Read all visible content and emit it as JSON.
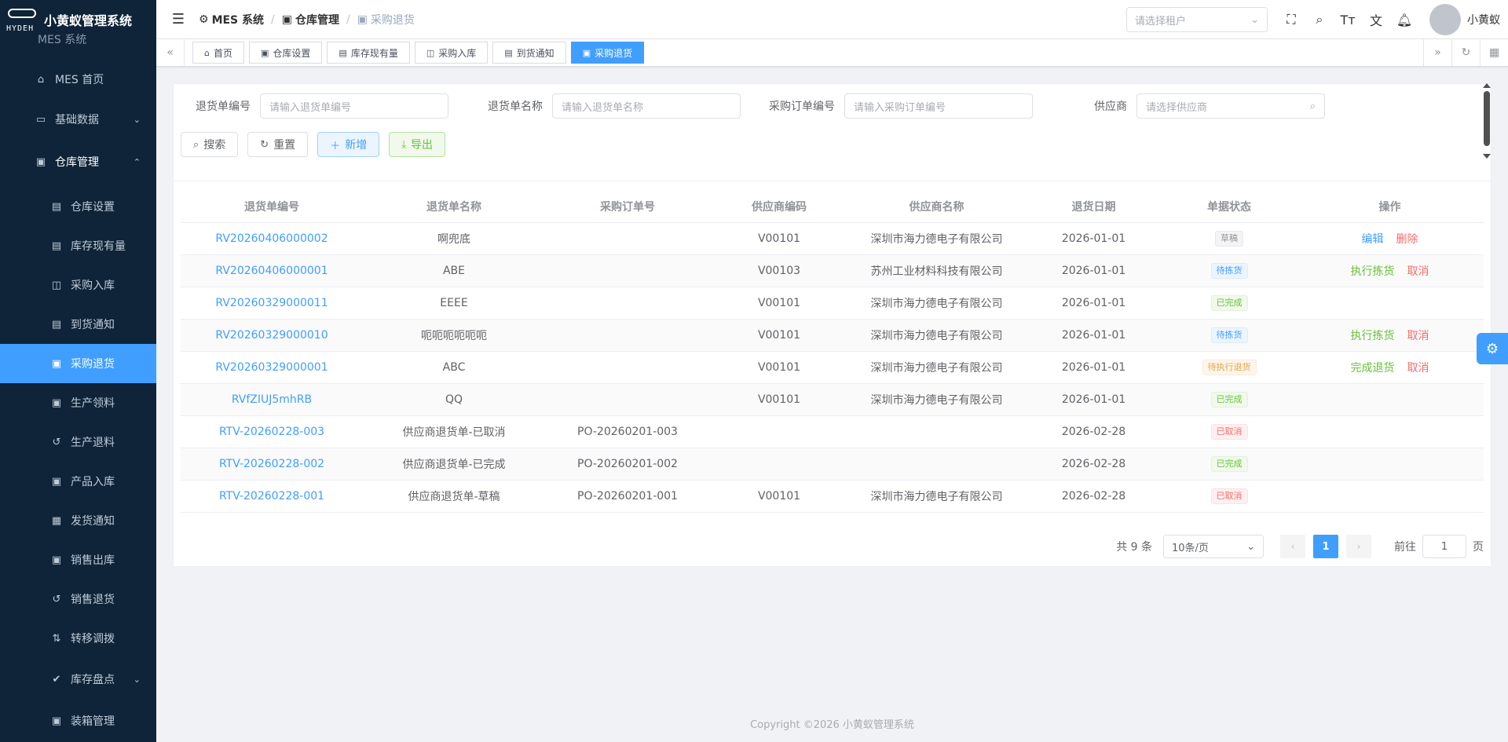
{
  "app": {
    "title": "小黄蚁管理系统",
    "logo_text": "HYDEH",
    "logo_sub": "MES 系统"
  },
  "sidebar": {
    "items": [
      {
        "label": "MES 首页",
        "icon": "home-icon",
        "glyph": "⌂",
        "level": 1,
        "active": false,
        "arrow": ""
      },
      {
        "label": "基础数据",
        "icon": "monitor-icon",
        "glyph": "▭",
        "level": 1,
        "active": false,
        "arrow": "⌄"
      },
      {
        "label": "仓库管理",
        "icon": "warehouse-icon",
        "glyph": "▣",
        "level": 1,
        "active": false,
        "arrow": "⌃",
        "parent": true
      },
      {
        "label": "仓库设置",
        "icon": "document-icon",
        "glyph": "▤",
        "level": 2,
        "active": false
      },
      {
        "label": "库存现有量",
        "icon": "document-icon",
        "glyph": "▤",
        "level": 2,
        "active": false
      },
      {
        "label": "采购入库",
        "icon": "bag-icon",
        "glyph": "◫",
        "level": 2,
        "active": false
      },
      {
        "label": "到货通知",
        "icon": "document-icon",
        "glyph": "▤",
        "level": 2,
        "active": false
      },
      {
        "label": "采购退货",
        "icon": "box-icon",
        "glyph": "▣",
        "level": 2,
        "active": true
      },
      {
        "label": "生产领料",
        "icon": "box-icon",
        "glyph": "▣",
        "level": 2,
        "active": false
      },
      {
        "label": "生产退料",
        "icon": "return-icon",
        "glyph": "↺",
        "level": 2,
        "active": false
      },
      {
        "label": "产品入库",
        "icon": "box-icon",
        "glyph": "▣",
        "level": 2,
        "active": false
      },
      {
        "label": "发货通知",
        "icon": "delivery-icon",
        "glyph": "▦",
        "level": 2,
        "active": false
      },
      {
        "label": "销售出库",
        "icon": "box-icon",
        "glyph": "▣",
        "level": 2,
        "active": false
      },
      {
        "label": "销售退货",
        "icon": "return-icon",
        "glyph": "↺",
        "level": 2,
        "active": false
      },
      {
        "label": "转移调拨",
        "icon": "transfer-icon",
        "glyph": "⇅",
        "level": 2,
        "active": false
      },
      {
        "label": "库存盘点",
        "icon": "check-circle-icon",
        "glyph": "✔",
        "level": 2,
        "active": false,
        "arrow": "⌄"
      },
      {
        "label": "装箱管理",
        "icon": "box-icon",
        "glyph": "▣",
        "level": 2,
        "active": false
      }
    ]
  },
  "navbar": {
    "breadcrumb": [
      "MES 系统",
      "仓库管理",
      "采购退货"
    ],
    "tenant_placeholder": "请选择租户",
    "username": "小黄蚁"
  },
  "tags": [
    "首页",
    "仓库设置",
    "库存现有量",
    "采购入库",
    "到货通知",
    "采购退货"
  ],
  "active_tag": "采购退货",
  "search": {
    "fields": [
      {
        "label": "退货单编号",
        "placeholder": "请输入退货单编号"
      },
      {
        "label": "退货单名称",
        "placeholder": "请输入退货单名称"
      },
      {
        "label": "采购订单编号",
        "placeholder": "请输入采购订单编号"
      },
      {
        "label": "供应商",
        "placeholder": "请选择供应商"
      }
    ],
    "buttons": {
      "search": "搜索",
      "reset": "重置",
      "add": "新增",
      "export": "导出"
    }
  },
  "table": {
    "headers": [
      "退货单编号",
      "退货单名称",
      "采购订单号",
      "供应商编码",
      "供应商名称",
      "退货日期",
      "单据状态",
      "操作"
    ],
    "rows": [
      {
        "code": "RV20260406000002",
        "name": "啊兜底",
        "po": "",
        "vendor_code": "V00101",
        "vendor_name": "深圳市海力德电子有限公司",
        "date": "2026-01-01",
        "status": "草稿",
        "status_type": "info",
        "ops": [
          {
            "label": "编辑",
            "type": "blue"
          },
          {
            "label": "删除",
            "type": "red"
          }
        ]
      },
      {
        "code": "RV20260406000001",
        "name": "ABE",
        "po": "",
        "vendor_code": "V00103",
        "vendor_name": "苏州工业材料科技有限公司",
        "date": "2026-01-01",
        "status": "待拣货",
        "status_type": "primary",
        "ops": [
          {
            "label": "执行拣货",
            "type": "green"
          },
          {
            "label": "取消",
            "type": "red"
          }
        ]
      },
      {
        "code": "RV20260329000011",
        "name": "EEEE",
        "po": "",
        "vendor_code": "V00101",
        "vendor_name": "深圳市海力德电子有限公司",
        "date": "2026-01-01",
        "status": "已完成",
        "status_type": "success",
        "ops": []
      },
      {
        "code": "RV20260329000010",
        "name": "呃呃呃呃呃呃",
        "po": "",
        "vendor_code": "V00101",
        "vendor_name": "深圳市海力德电子有限公司",
        "date": "2026-01-01",
        "status": "待拣货",
        "status_type": "primary",
        "ops": [
          {
            "label": "执行拣货",
            "type": "green"
          },
          {
            "label": "取消",
            "type": "red"
          }
        ]
      },
      {
        "code": "RV20260329000001",
        "name": "ABC",
        "po": "",
        "vendor_code": "V00101",
        "vendor_name": "深圳市海力德电子有限公司",
        "date": "2026-01-01",
        "status": "待执行退货",
        "status_type": "warning",
        "ops": [
          {
            "label": "完成退货",
            "type": "green"
          },
          {
            "label": "取消",
            "type": "red"
          }
        ]
      },
      {
        "code": "RVfZIUJ5mhRB",
        "name": "QQ",
        "po": "",
        "vendor_code": "V00101",
        "vendor_name": "深圳市海力德电子有限公司",
        "date": "2026-01-01",
        "status": "已完成",
        "status_type": "success",
        "ops": []
      },
      {
        "code": "RTV-20260228-003",
        "name": "供应商退货单-已取消",
        "po": "PO-20260201-003",
        "vendor_code": "",
        "vendor_name": "",
        "date": "2026-02-28",
        "status": "已取消",
        "status_type": "danger",
        "ops": []
      },
      {
        "code": "RTV-20260228-002",
        "name": "供应商退货单-已完成",
        "po": "PO-20260201-002",
        "vendor_code": "",
        "vendor_name": "",
        "date": "2026-02-28",
        "status": "已完成",
        "status_type": "success",
        "ops": []
      },
      {
        "code": "RTV-20260228-001",
        "name": "供应商退货单-草稿",
        "po": "PO-20260201-001",
        "vendor_code": "V00101",
        "vendor_name": "深圳市海力德电子有限公司",
        "date": "2026-02-28",
        "status": "已取消",
        "status_type": "danger",
        "ops": []
      }
    ]
  },
  "pagination": {
    "total": "共 9 条",
    "page_size": "10条/页",
    "current": "1",
    "goto_prefix": "前往",
    "goto_value": "1",
    "goto_suffix": "页"
  },
  "footer": "Copyright ©2026 小黄蚁管理系统",
  "colors": {
    "sidebar_bg": "#0f2438",
    "primary": "#409eff",
    "success": "#67c23a",
    "danger": "#f56c6c",
    "warning": "#e6a23c"
  }
}
